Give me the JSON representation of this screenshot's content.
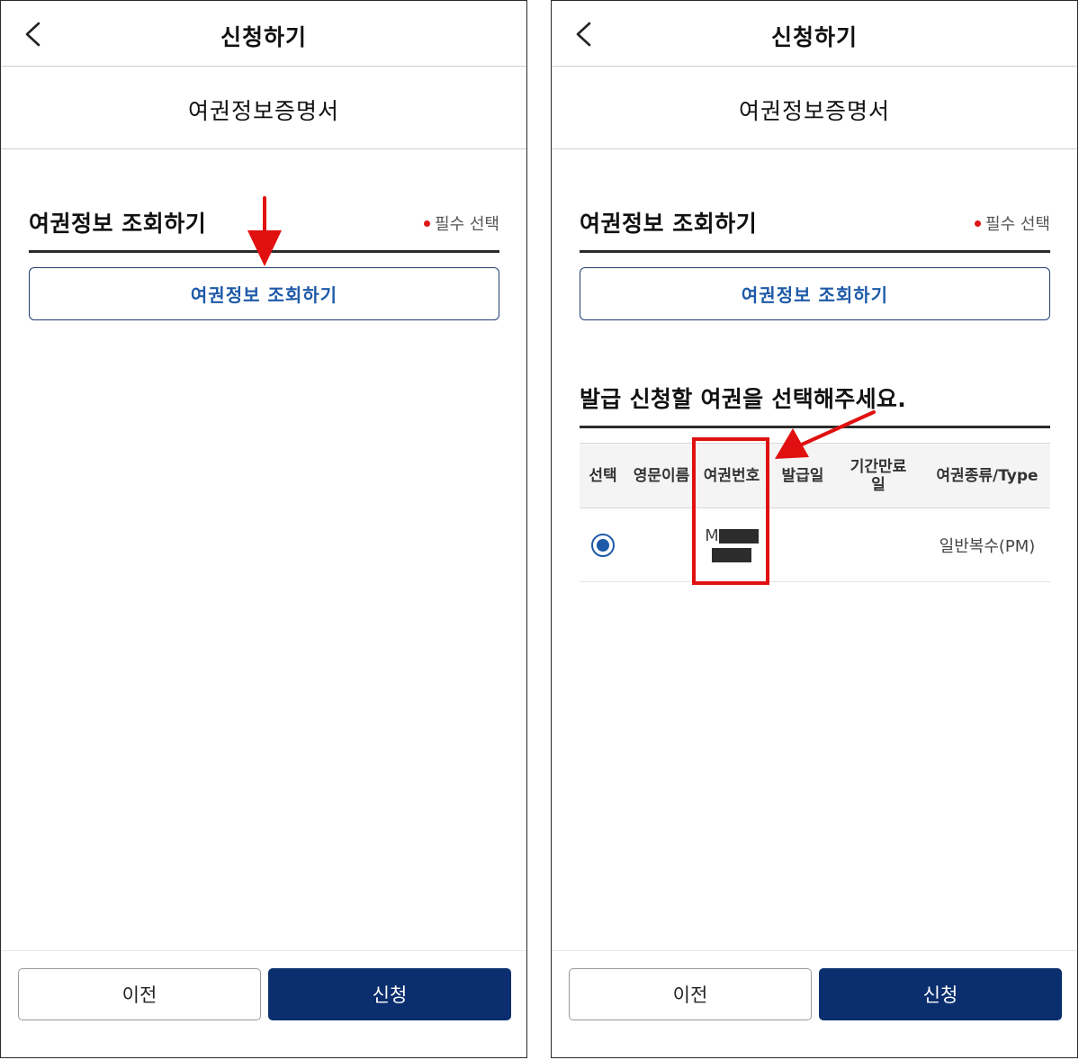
{
  "colors": {
    "navy": "#0b2f6e",
    "accent_blue": "#1e5aa8",
    "required_dot": "#e01515",
    "annotation_red": "#e11010"
  },
  "left_screen": {
    "header": {
      "back_icon": "chevron-left-icon",
      "title": "신청하기"
    },
    "subheader": {
      "title": "여권정보증명서"
    },
    "section": {
      "title": "여권정보 조회하기",
      "required_label": "필수 선택",
      "lookup_button": "여권정보 조회하기"
    },
    "footer": {
      "prev_label": "이전",
      "submit_label": "신청"
    }
  },
  "right_screen": {
    "header": {
      "back_icon": "chevron-left-icon",
      "title": "신청하기"
    },
    "subheader": {
      "title": "여권정보증명서"
    },
    "section": {
      "title": "여권정보 조회하기",
      "required_label": "필수 선택",
      "lookup_button": "여권정보 조회하기"
    },
    "select_title": "발급 신청할 여권을 선택해주세요.",
    "table": {
      "columns": [
        "선택",
        "영문이름",
        "여권번호",
        "발급일",
        "기간만료일",
        "여권종류/Type"
      ],
      "rows": [
        {
          "selected": true,
          "english_name": "",
          "passport_number_prefix": "M",
          "issue_date": "",
          "expiry_date": "",
          "passport_type": "일반복수(PM)"
        }
      ]
    },
    "footer": {
      "prev_label": "이전",
      "submit_label": "신청"
    }
  }
}
